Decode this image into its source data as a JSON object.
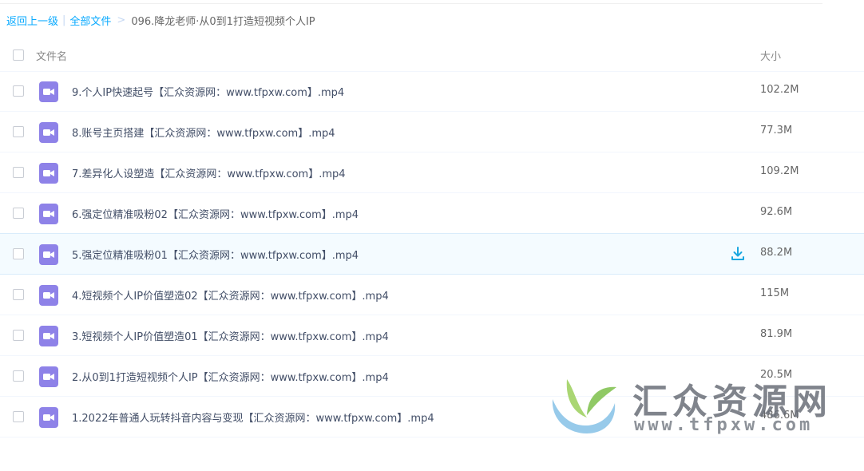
{
  "breadcrumb": {
    "back_label": "返回上一级",
    "separator_pipe": "|",
    "all_files_label": "全部文件",
    "separator_gt": ">",
    "current_folder": "096.降龙老师·从0到1打造短视频个人IP"
  },
  "table": {
    "col_name": "文件名",
    "col_size": "大小",
    "rows": [
      {
        "name": "9.个人IP快速起号【汇众资源网：www.tfpxw.com】.mp4",
        "size": "102.2M"
      },
      {
        "name": "8.账号主页搭建【汇众资源网：www.tfpxw.com】.mp4",
        "size": "77.3M"
      },
      {
        "name": "7.差异化人设塑造【汇众资源网：www.tfpxw.com】.mp4",
        "size": "109.2M"
      },
      {
        "name": "6.强定位精准吸粉02【汇众资源网：www.tfpxw.com】.mp4",
        "size": "92.6M"
      },
      {
        "name": "5.强定位精准吸粉01【汇众资源网：www.tfpxw.com】.mp4",
        "size": "88.2M"
      },
      {
        "name": "4.短视频个人IP价值塑造02【汇众资源网：www.tfpxw.com】.mp4",
        "size": "115M"
      },
      {
        "name": "3.短视频个人IP价值塑造01【汇众资源网：www.tfpxw.com】.mp4",
        "size": "81.9M"
      },
      {
        "name": "2.从0到1打造短视频个人IP【汇众资源网：www.tfpxw.com】.mp4",
        "size": "20.5M"
      },
      {
        "name": "1.2022年普通人玩转抖音内容与变现【汇众资源网：www.tfpxw.com】.mp4",
        "size": "486.6M"
      }
    ],
    "hovered_row_index": 4
  },
  "watermark": {
    "title": "汇众资源网",
    "url": "www.tfpxw.com"
  },
  "colors": {
    "link": "#09aaff",
    "video_icon": "#8e82e8",
    "download_icon": "#1aa7e0"
  },
  "icons": {
    "file": "video-file-icon",
    "download": "download-icon"
  }
}
